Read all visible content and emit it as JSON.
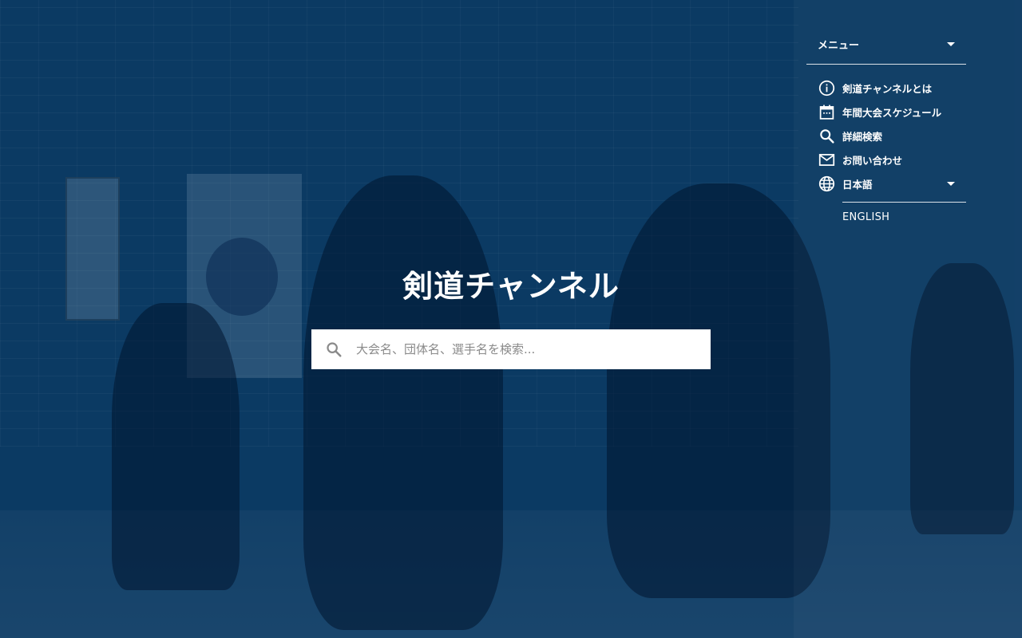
{
  "site": {
    "title": "剣道チャンネル"
  },
  "search": {
    "placeholder": "大会名、団体名、選手名を検索...",
    "value": "",
    "icon": "search-icon"
  },
  "nav": {
    "menu_label": "メニュー",
    "items": [
      {
        "label": "剣道チャンネルとは",
        "icon": "info-icon"
      },
      {
        "label": "年間大会スケジュール",
        "icon": "calendar-icon"
      },
      {
        "label": "詳細検索",
        "icon": "search-icon"
      },
      {
        "label": "お問い合わせ",
        "icon": "mail-icon"
      }
    ],
    "language": {
      "current": "日本語",
      "icon": "globe-icon",
      "options": [
        "ENGLISH"
      ]
    }
  },
  "colors": {
    "overlay": "#0b3a63",
    "text": "#ffffff",
    "search_bg": "#ffffff",
    "placeholder": "#8a8a8a"
  }
}
